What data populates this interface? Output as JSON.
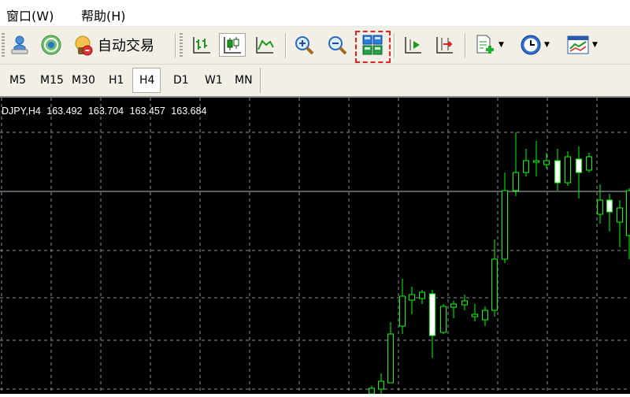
{
  "menu": {
    "window": "窗口(W)",
    "help": "帮助(H)"
  },
  "toolbar": {
    "auto_trading_label": "自动交易",
    "icons": [
      "market-watch-icon",
      "signal-broadcast-icon",
      "auto-trading-icon",
      "bar-chart-icon",
      "candlestick-chart-icon",
      "line-chart-icon",
      "zoom-in-icon",
      "zoom-out-icon",
      "tile-windows-icon",
      "chart-shift-icon",
      "auto-scroll-icon",
      "indicators-icon",
      "periods-clock-icon",
      "templates-icon"
    ]
  },
  "timeframes": [
    "M5",
    "M15",
    "M30",
    "H1",
    "H4",
    "D1",
    "W1",
    "MN"
  ],
  "active_timeframe": "H4",
  "chart": {
    "symbol": "DJPY,H4",
    "open": "163.492",
    "high": "163.704",
    "low": "163.457",
    "close": "163.684",
    "colors": {
      "background": "#000000",
      "grid": "#8a8f99",
      "bull": "#00ff00",
      "bear_body": "#ffffff",
      "price_line": "#c0c0c0"
    }
  }
}
